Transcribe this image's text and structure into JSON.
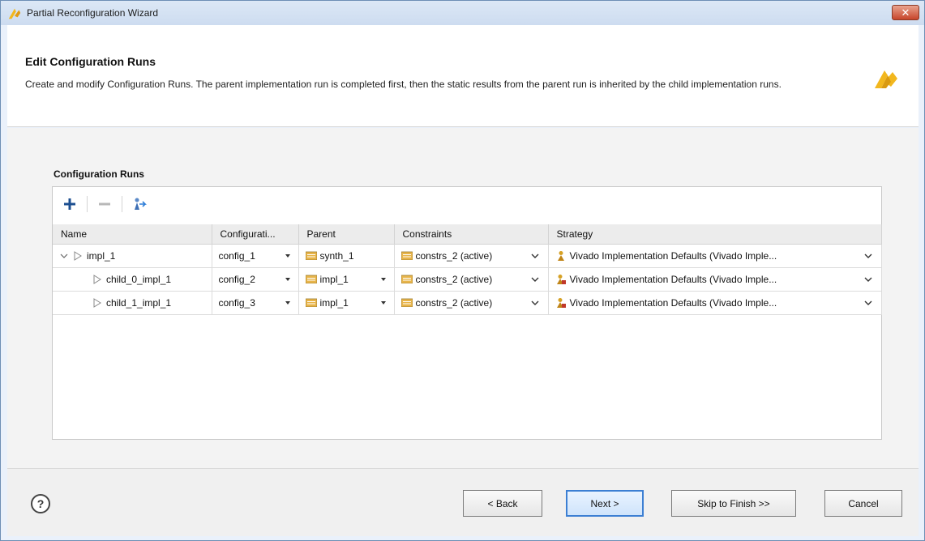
{
  "window": {
    "title": "Partial Reconfiguration Wizard",
    "close_glyph": "✕"
  },
  "header": {
    "title": "Edit Configuration Runs",
    "description": "Create and modify Configuration Runs. The parent implementation run is completed first, then the static results from the parent run is inherited by the child implementation runs."
  },
  "section": {
    "label": "Configuration Runs"
  },
  "toolbar": {
    "icons": [
      "add-icon",
      "remove-icon",
      "auto-create-icon"
    ]
  },
  "table": {
    "columns": [
      "Name",
      "Configurati...",
      "Parent",
      "Constraints",
      "Strategy"
    ],
    "rows": [
      {
        "name": "impl_1",
        "configuration": "config_1",
        "parent": "synth_1",
        "constraints": "constrs_2 (active)",
        "strategy": "Vivado Implementation Defaults (Vivado Imple..."
      },
      {
        "name": "child_0_impl_1",
        "configuration": "config_2",
        "parent": "impl_1",
        "constraints": "constrs_2 (active)",
        "strategy": "Vivado Implementation Defaults (Vivado Imple..."
      },
      {
        "name": "child_1_impl_1",
        "configuration": "config_3",
        "parent": "impl_1",
        "constraints": "constrs_2 (active)",
        "strategy": "Vivado Implementation Defaults (Vivado Imple..."
      }
    ]
  },
  "footer": {
    "help_label": "?",
    "back_label": "< Back",
    "next_label": "Next >",
    "skip_label": "Skip to Finish >>",
    "cancel_label": "Cancel"
  },
  "colors": {
    "accent": "#3c7fd3",
    "logo": "#f2b71e",
    "folder": "#e8b54a"
  }
}
